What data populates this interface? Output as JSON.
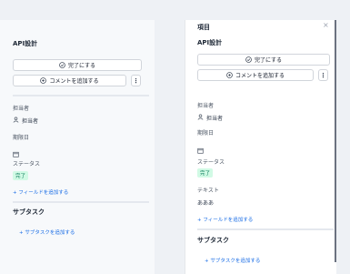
{
  "left": {
    "title": "API設計",
    "complete_label": "完了にする",
    "add_comment_label": "コメントを追加する",
    "more_label": "⋮",
    "assignee_label": "担当者",
    "assignee_value": "担当者",
    "due_label": "期限日",
    "status_label": "ステータス",
    "status_value": "完了",
    "add_field_label": "+ フィールドを追加する",
    "subtasks_title": "サブタスク",
    "add_subtask_label": "+ サブタスクを追加する"
  },
  "right": {
    "header": "項目",
    "close": "×",
    "title": "API設計",
    "complete_label": "完了にする",
    "add_comment_label": "コメントを追加する",
    "more_label": "⋮",
    "assignee_label": "担当者",
    "assignee_value": "担当者",
    "due_label": "期限日",
    "status_label": "ステータス",
    "status_value": "完了",
    "text_label": "テキスト",
    "text_value": "あああ",
    "add_field_label": "+ フィールドを追加する",
    "subtasks_title": "サブタスク",
    "add_subtask_label": "+ サブタスクを追加する"
  },
  "colors": {
    "accent": "#1d6fe6",
    "status_bg": "#d1fae5",
    "status_text": "#047857"
  }
}
